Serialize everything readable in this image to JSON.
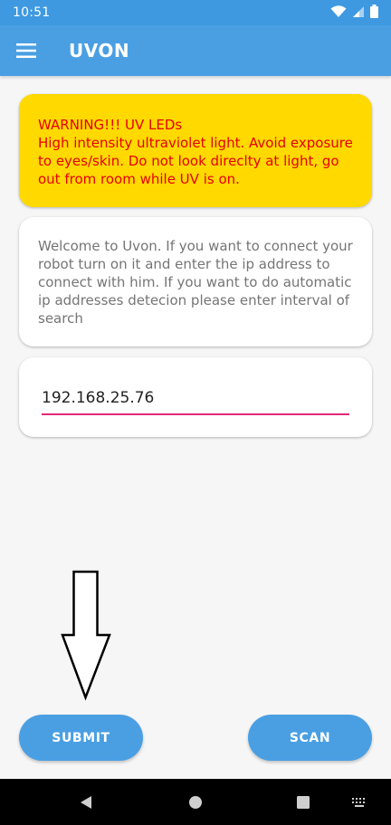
{
  "status_bar": {
    "time": "10:51",
    "icons": [
      "wifi-icon",
      "signal-icon",
      "battery-icon"
    ]
  },
  "app_bar": {
    "menu_icon": "hamburger-menu-icon",
    "title": "UVON"
  },
  "warning": {
    "title": "WARNING!!! UV LEDs",
    "message": "High intensity ultraviolet light. Avoid exposure to eyes/skin. Do not look direclty at light, go out from room while UV is on."
  },
  "info": {
    "text": "Welcome to Uvon. If you want to connect your robot turn on it and enter the ip address to connect with him. If you want to do automatic ip addresses detecion please enter interval of search"
  },
  "ip_field": {
    "value": "192.168.25.76"
  },
  "annotation": {
    "icon": "down-arrow-icon"
  },
  "buttons": {
    "submit_label": "SUBMIT",
    "scan_label": "SCAN"
  },
  "nav_bar": {
    "icons": [
      "back-icon",
      "home-icon",
      "recents-icon",
      "keyboard-icon"
    ]
  },
  "colors": {
    "primary": "#4a9fe3",
    "warning_bg": "#ffd900",
    "warning_text": "#e60000",
    "input_underline": "#e2287a"
  }
}
